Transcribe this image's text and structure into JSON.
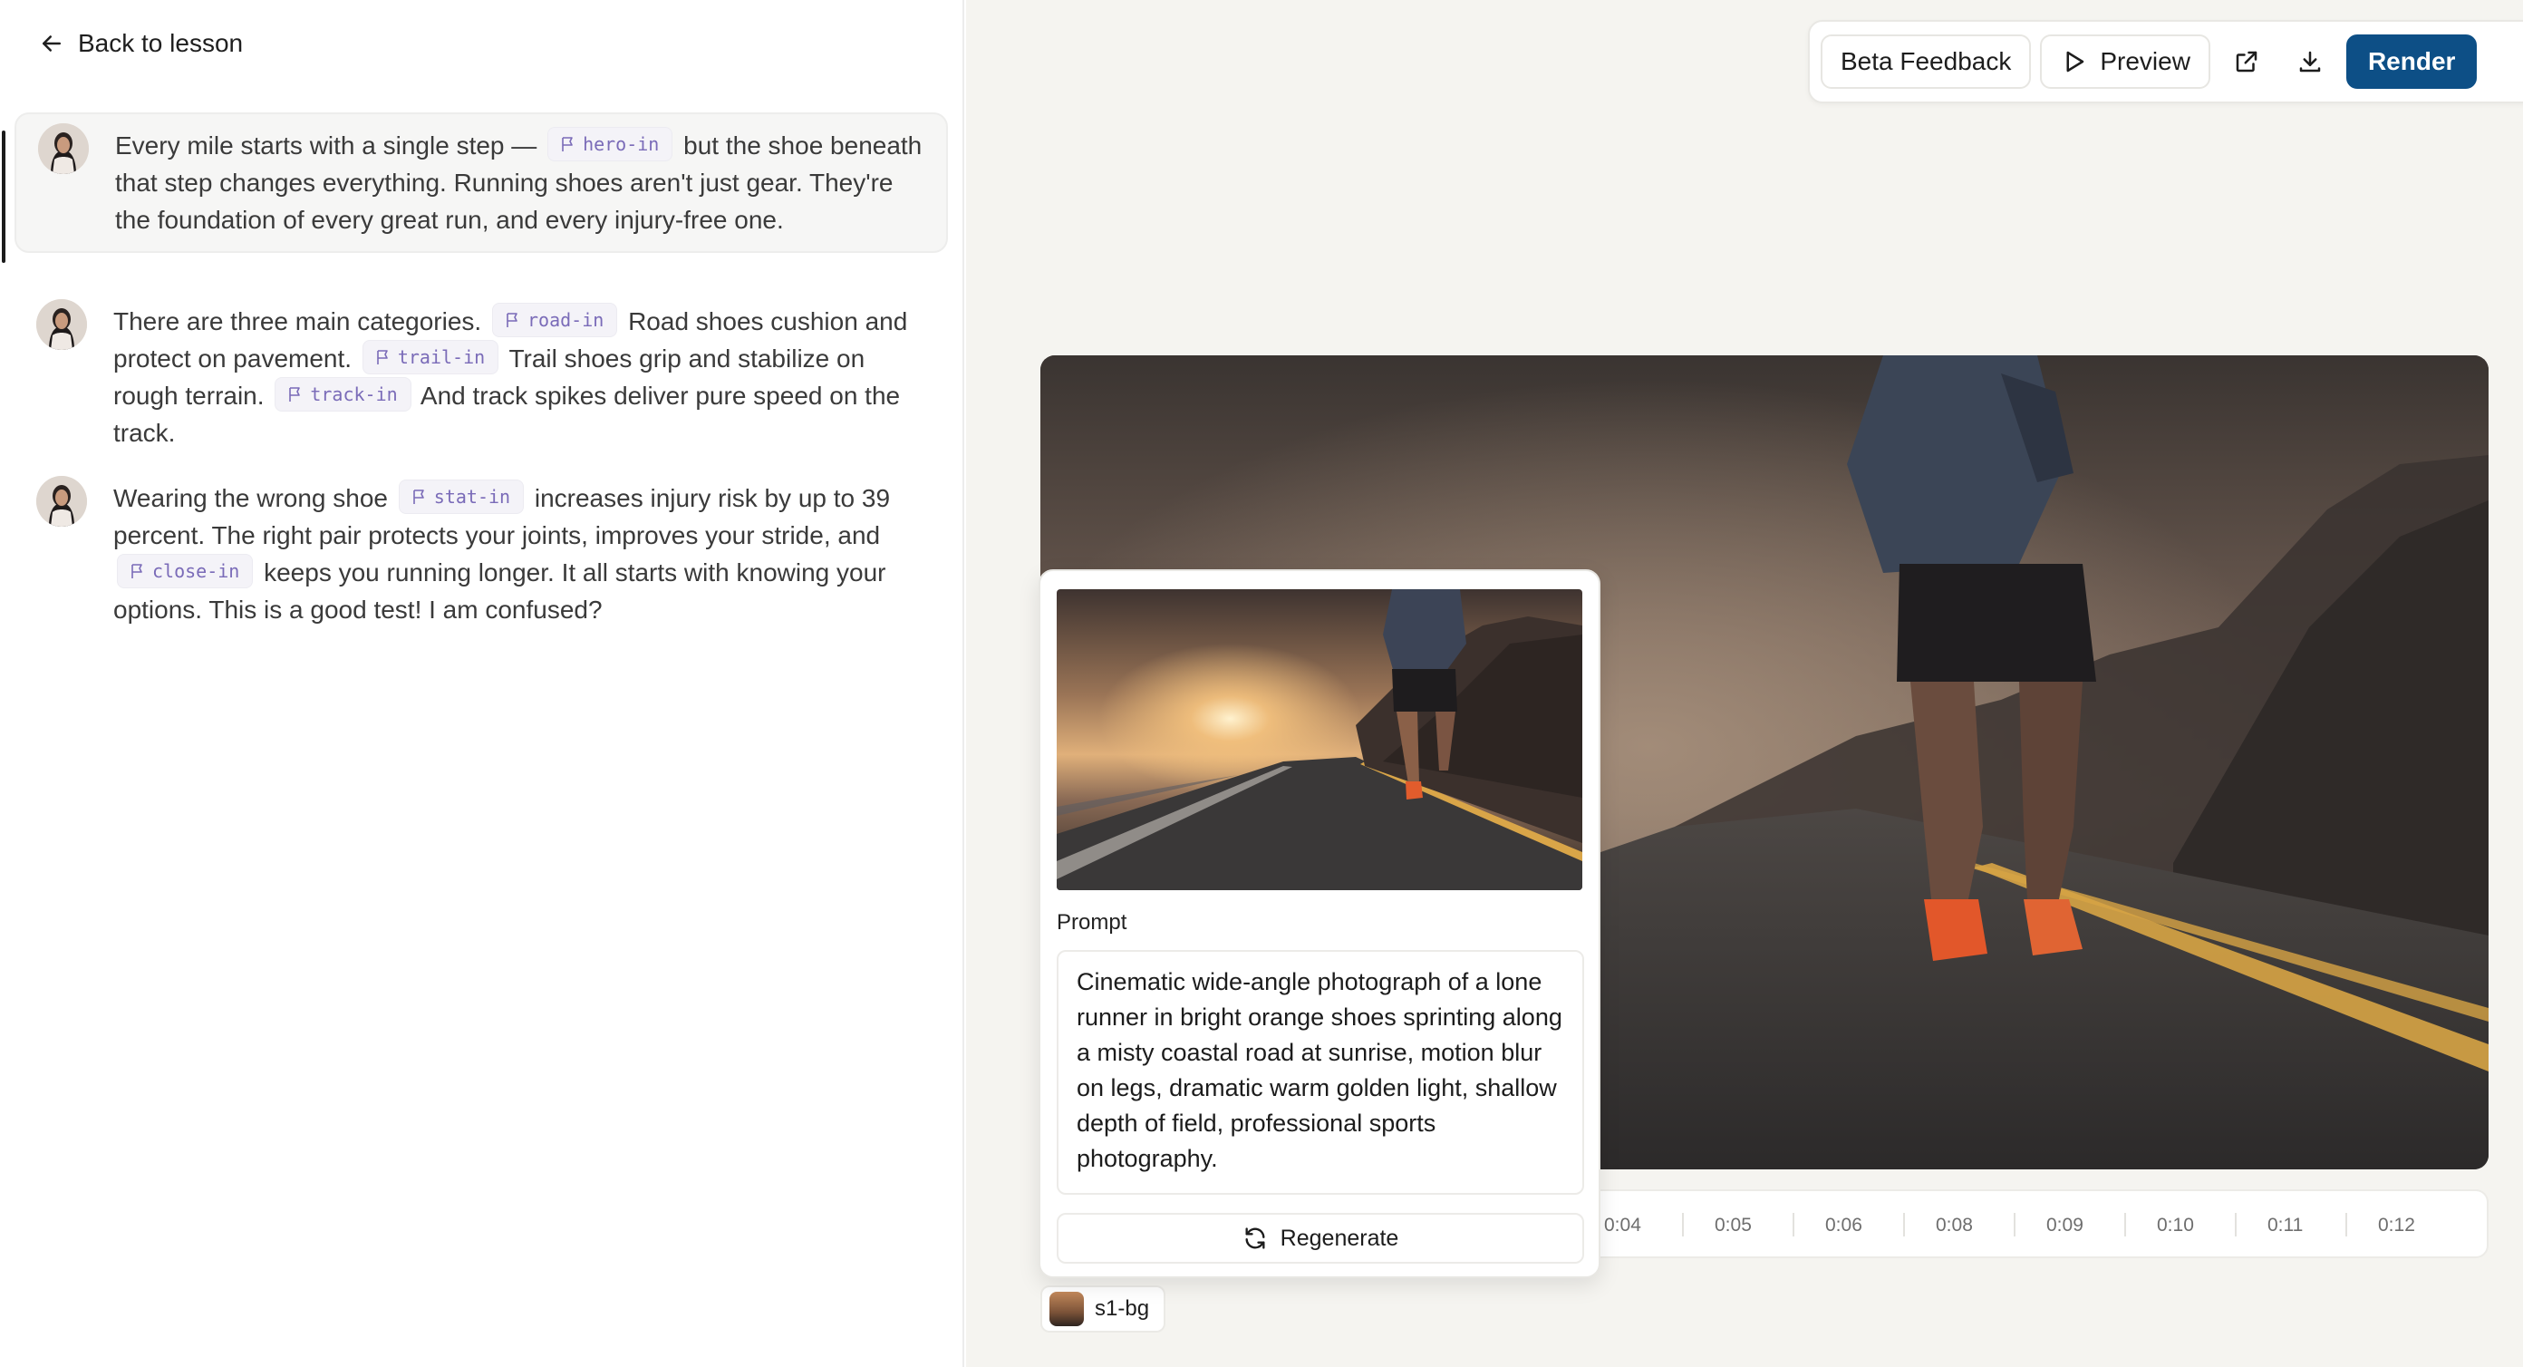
{
  "nav": {
    "back_label": "Back to lesson"
  },
  "script": [
    {
      "active": true,
      "parts": [
        {
          "text": "Every mile starts with a single step —"
        },
        {
          "tag": "hero-in"
        },
        {
          "text": "but the shoe beneath that step changes everything. Running shoes aren't just gear. They're the foundation of every great run, and every injury-free one."
        }
      ]
    },
    {
      "active": false,
      "parts": [
        {
          "text": "There are three main categories."
        },
        {
          "tag": "road-in"
        },
        {
          "text": "Road shoes cushion and protect on pavement."
        },
        {
          "tag": "trail-in"
        },
        {
          "text": "Trail shoes grip and stabilize on rough terrain."
        },
        {
          "tag": "track-in"
        },
        {
          "text": "And track spikes deliver pure speed on the track."
        }
      ]
    },
    {
      "active": false,
      "parts": [
        {
          "text": "Wearing the wrong shoe"
        },
        {
          "tag": "stat-in"
        },
        {
          "text": "increases injury risk by up to 39 percent. The right pair protects your joints, improves your stride, and"
        },
        {
          "tag": "close-in"
        },
        {
          "text": "keeps you running longer. It all starts with knowing your options. This is a good test! I am confused?"
        }
      ]
    }
  ],
  "toolbar": {
    "beta_feedback": "Beta Feedback",
    "preview": "Preview",
    "render": "Render"
  },
  "timeline": {
    "ticks": [
      "0:04",
      "0:05",
      "0:06",
      "0:08",
      "0:09",
      "0:10",
      "0:11",
      "0:12"
    ]
  },
  "clip": {
    "label": "s1-bg"
  },
  "popup": {
    "prompt_label": "Prompt",
    "prompt_text": "Cinematic wide-angle photograph of a lone runner in bright orange shoes sprinting along a misty coastal road at sunrise, motion blur on legs, dramatic warm golden light, shallow depth of field, professional sports photography.",
    "regenerate": "Regenerate"
  },
  "colors": {
    "accent": "#0d4f86",
    "tag_text": "#7a6bb8",
    "panel_bg": "#f5f4f0"
  }
}
